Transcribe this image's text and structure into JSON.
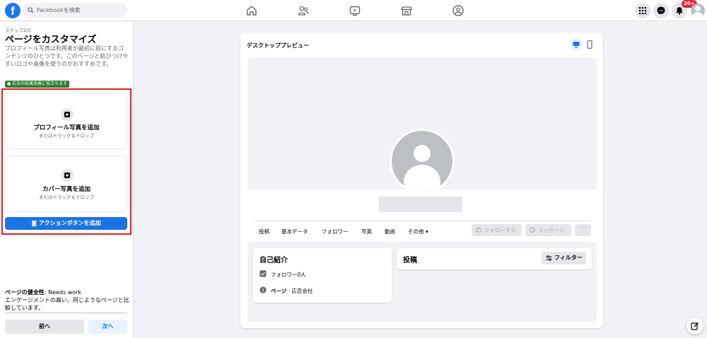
{
  "topbar": {
    "logo": "f",
    "search_placeholder": "Facebookを検索",
    "nav_icons": [
      "home-icon",
      "friends-icon",
      "watch-icon",
      "marketplace-icon",
      "groups-icon"
    ],
    "right_icons": [
      "menu-grid-icon",
      "messenger-icon",
      "bell-icon"
    ],
    "notification_badge": "20+"
  },
  "left": {
    "step": "ステップ2/5",
    "title": "ページをカスタマイズ",
    "description": "プロフィール写真は利用者が最初に目にするコンテンツのひとつです。このページと結びつけやすいロゴや画像を使うのがおすすめです。",
    "badge": "広告の結果改善に役立ちます",
    "profile_upload": {
      "title": "プロフィール写真を追加",
      "subtitle": "またはドラッグ＆ドロップ"
    },
    "cover_upload": {
      "title": "カバー写真を追加",
      "subtitle": "またはドラッグ＆ドロップ"
    },
    "action_button": "アクションボタンを追加",
    "health_label": "ページの健全性",
    "health_value": ": Needs work",
    "health_desc": "エンゲージメントの高い、同じようなページと比較しています。",
    "back_button": "前へ",
    "next_button": "次へ"
  },
  "preview": {
    "title": "デスクトッププレビュー",
    "tabs": [
      "投稿",
      "基本データ",
      "フォロワー",
      "写真",
      "動画",
      "その他 ▾"
    ],
    "follow_button": "フォローする",
    "message_button": "メッセージ",
    "more_button": "···",
    "intro_title": "自己紹介",
    "followers": "フォロワー0人",
    "page_label": "ページ",
    "page_category": " · 広告会社",
    "posts_title": "投稿",
    "filter_button": "フィルター"
  },
  "colors": {
    "brand": "#1877f2",
    "highlight": "#e41e1e",
    "badge_green": "#2e7d32"
  }
}
